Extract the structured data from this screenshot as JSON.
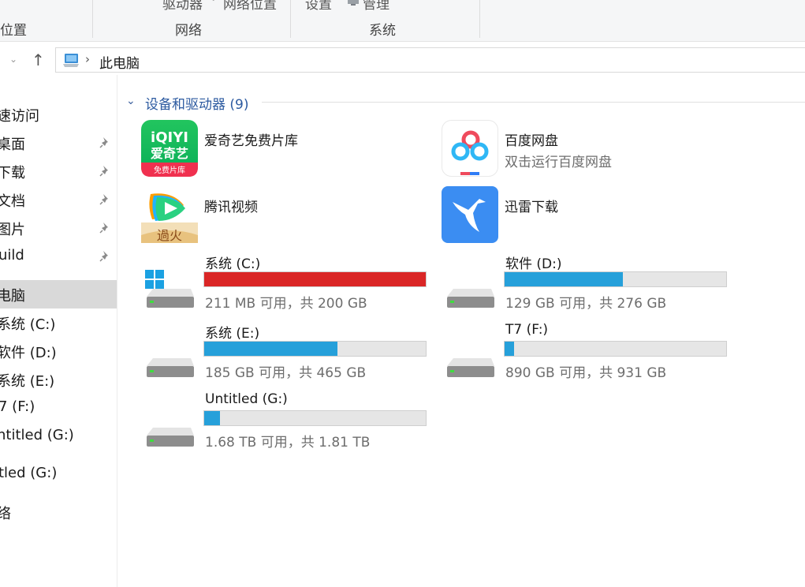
{
  "ribbon": {
    "top_left": "驱动器",
    "top_mid": "网络位置",
    "top_settings": "设置",
    "top_manage": "管理",
    "cap_location": "位置",
    "cap_network": "网络",
    "cap_system": "系统"
  },
  "address": {
    "crumb": "此电脑"
  },
  "nav": {
    "quick_access": "速访问",
    "desktop": "桌面",
    "downloads": "下载",
    "documents": "文档",
    "pictures": "图片",
    "build": "uild",
    "this_pc": "电脑",
    "drive_c": "系统 (C:)",
    "drive_d": "软件 (D:)",
    "drive_e": "系统 (E:)",
    "drive_f": "7 (F:)",
    "drive_g": "ntitled (G:)",
    "drive_g2": "tled (G:)",
    "network": "络"
  },
  "group": {
    "title": "设备和驱动器 (9)"
  },
  "apps": {
    "iqiyi": {
      "title": "爱奇艺免费片库",
      "logo_top": "iQIYI",
      "logo_mid": "爱奇艺",
      "logo_bot": "免费片库"
    },
    "baidu": {
      "title": "百度网盘",
      "sub": "双击运行百度网盘"
    },
    "tencent": {
      "title": "腾讯视频",
      "logo_text": "過火"
    },
    "xunlei": {
      "title": "迅雷下载"
    }
  },
  "drives": [
    {
      "name": "系统 (C:)",
      "free": "211 MB 可用，共 200 GB",
      "used_fraction": 0.999,
      "color": "#da2626"
    },
    {
      "name": "软件 (D:)",
      "free": "129 GB 可用，共 276 GB",
      "used_fraction": 0.533,
      "color": "#26a0da"
    },
    {
      "name": "系统 (E:)",
      "free": "185 GB 可用，共 465 GB",
      "used_fraction": 0.602,
      "color": "#26a0da"
    },
    {
      "name": "T7 (F:)",
      "free": "890 GB 可用，共 931 GB",
      "used_fraction": 0.044,
      "color": "#26a0da"
    },
    {
      "name": "Untitled (G:)",
      "free": "1.68 TB 可用，共 1.81 TB",
      "used_fraction": 0.072,
      "color": "#26a0da"
    }
  ]
}
